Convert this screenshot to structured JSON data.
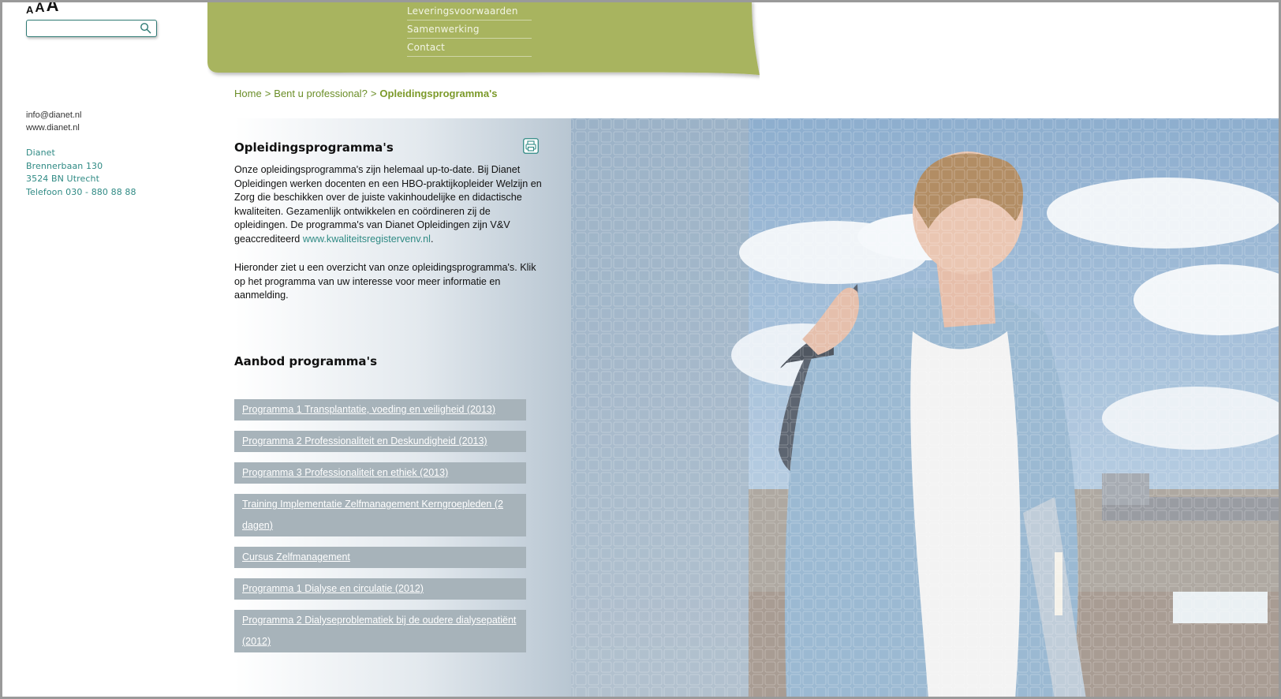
{
  "font_sizer": [
    "A",
    "A",
    "A"
  ],
  "search": {
    "placeholder": ""
  },
  "contact": {
    "email": "info@dianet.nl",
    "website": "www.dianet.nl"
  },
  "address": {
    "name": "Dianet",
    "street": "Brennerbaan 130",
    "city": "3524 BN  Utrecht",
    "phone": "Telefoon 030 - 880 88 88"
  },
  "menu": {
    "items": [
      "Leveringsvoorwaarden",
      "Samenwerking",
      "Contact"
    ],
    "color": "#a8b45e"
  },
  "breadcrumb": {
    "home": "Home",
    "sep1": ">",
    "parent": "Bent u professional?",
    "sep2": ">",
    "current": "Opleidingsprogramma's"
  },
  "content": {
    "title": "Opleidingsprogramma's",
    "intro_text": "Onze opleidingsprogramma's zijn helemaal up-to-date. Bij Dianet Opleidingen werken docenten en een HBO-praktijkopleider Welzijn en Zorg die beschikken over de juiste vakinhoudelijke en didactische kwaliteiten. Gezamenlijk ontwikkelen en coördineren zij de opleidingen. De programma's van Dianet Opleidingen zijn V&V geaccrediteerd ",
    "intro_link": "www.kwaliteitsregistervenv.nl",
    "intro_end": ".",
    "intro2": "Hieronder ziet u een overzicht van onze opleidingsprogramma's. Klik op het programma van uw interesse voor meer informatie en aanmelding.",
    "section_title": "Aanbod programma's",
    "programs": [
      "Programma 1 Transplantatie, voeding en veiligheid (2013)",
      "Programma 2 Professionaliteit en Deskundigheid (2013)",
      "Programma 3 Professionaliteit en ethiek (2013)",
      "Training Implementatie Zelfmanagement Kerngroepleden (2 dagen)",
      "Cursus Zelfmanagement",
      "Programma 1 Dialyse en circulatie (2012)",
      "Programma 2 Dialyseproblematiek bij de oudere dialysepatiënt (2012)"
    ]
  },
  "icons": {
    "search": "search-icon",
    "print": "print-icon"
  },
  "colors": {
    "accent_green": "#7c9a2a",
    "teal": "#2f8a84",
    "program_bg": "#a7b3ba"
  }
}
